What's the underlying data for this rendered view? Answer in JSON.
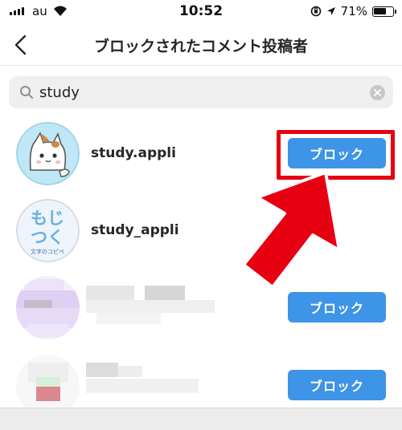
{
  "status_bar": {
    "carrier": "au",
    "time": "10:52",
    "battery": "71%",
    "battery_level": 0.71
  },
  "nav": {
    "title": "ブロックされたコメント投稿者"
  },
  "search": {
    "value": "study"
  },
  "avatar_text": {
    "line1": "もじ",
    "line2": "つく",
    "caption": "文字のコピペ"
  },
  "users": [
    {
      "username": "study.appli",
      "button": "ブロック"
    },
    {
      "username": "study_appli"
    },
    {
      "username": "",
      "button": "ブロック"
    },
    {
      "username": "",
      "button": "ブロック"
    }
  ],
  "colors": {
    "accent": "#3e94e6",
    "highlight": "#e60012"
  }
}
